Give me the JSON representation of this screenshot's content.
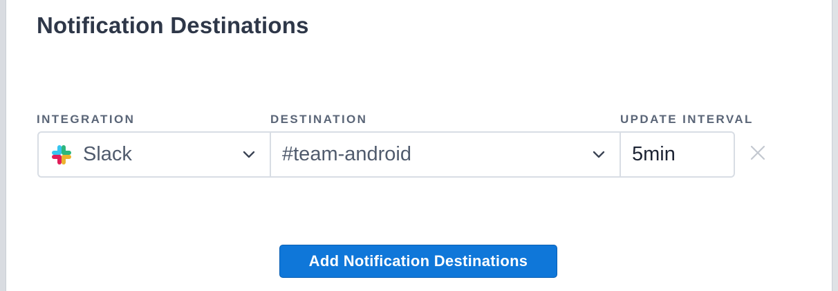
{
  "modal": {
    "title": "Notification Destinations"
  },
  "labels": {
    "integration": "INTEGRATION",
    "destination": "DESTINATION",
    "update_interval": "UPDATE INTERVAL"
  },
  "row": {
    "integration": {
      "icon": "slack-logo-icon",
      "value": "Slack"
    },
    "destination": {
      "value": "#team-android"
    },
    "update_interval": {
      "value": "5min"
    },
    "remove_icon": "close-icon"
  },
  "actions": {
    "add_label": "Add Notification Destinations"
  },
  "colors": {
    "primary_button": "#0f77d9",
    "title_text": "#2e3748",
    "label_text": "#5a6577",
    "border": "#d8dde4",
    "slack_blue": "#36c5f0",
    "slack_green": "#2eb67d",
    "slack_yellow": "#ecb22e",
    "slack_red": "#e01e5a"
  }
}
